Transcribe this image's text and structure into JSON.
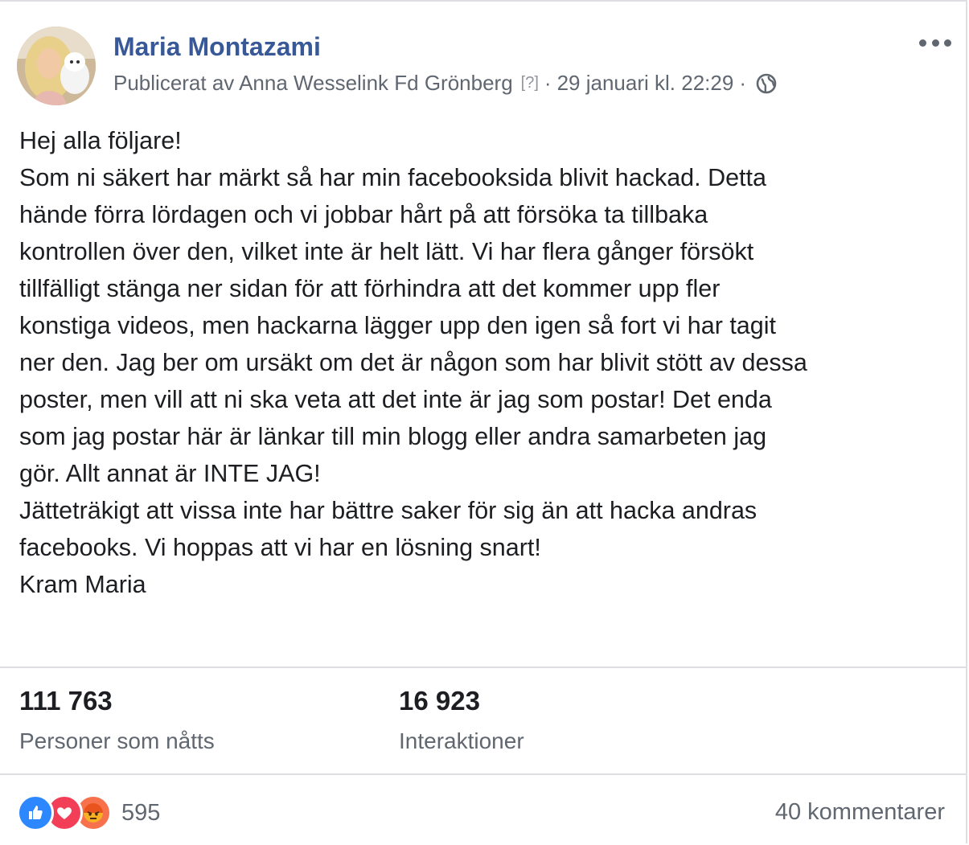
{
  "post": {
    "author": "Maria Montazami",
    "published_by": "Publicerat av Anna Wesselink Fd Grönberg",
    "help_marker": "[?]",
    "separator": "·",
    "timestamp": "29 januari kl. 22:29",
    "audience_icon": "globe-icon",
    "more_icon": "more-options-icon",
    "lines": [
      "Hej alla följare!",
      "Som ni säkert har märkt så har min facebooksida blivit hackad. Detta",
      "hände förra lördagen och vi jobbar hårt på att försöka ta tillbaka",
      "kontrollen över den, vilket inte är helt lätt. Vi har flera gånger försökt",
      "tillfälligt stänga ner sidan för att förhindra att det kommer upp fler",
      "konstiga videos, men hackarna lägger upp den igen så fort vi har tagit",
      "ner den. Jag ber om ursäkt om det är någon som har blivit stött av dessa",
      "poster, men vill att ni ska veta att det inte är jag som postar! Det enda",
      "som jag postar här är länkar till min blogg eller andra samarbeten jag",
      "gör. Allt annat är INTE JAG!",
      "Jätteträkigt att vissa inte har bättre saker för sig än att hacka andras",
      "facebooks. Vi hoppas att vi har en lösning snart!",
      "Kram Maria"
    ]
  },
  "stats": {
    "reach_value": "111 763",
    "reach_label": "Personer som nåtts",
    "engagement_value": "16 923",
    "engagement_label": "Interaktioner"
  },
  "footer": {
    "reaction_icons": [
      "like-icon",
      "love-icon",
      "angry-icon"
    ],
    "reaction_count": "595",
    "comments": "40 kommentarer"
  },
  "colors": {
    "author_link": "#385898",
    "secondary_text": "#606770",
    "divider": "#dddfe2",
    "like": "#2d88ff",
    "love": "#f33e58",
    "angry": "#f7714c"
  }
}
